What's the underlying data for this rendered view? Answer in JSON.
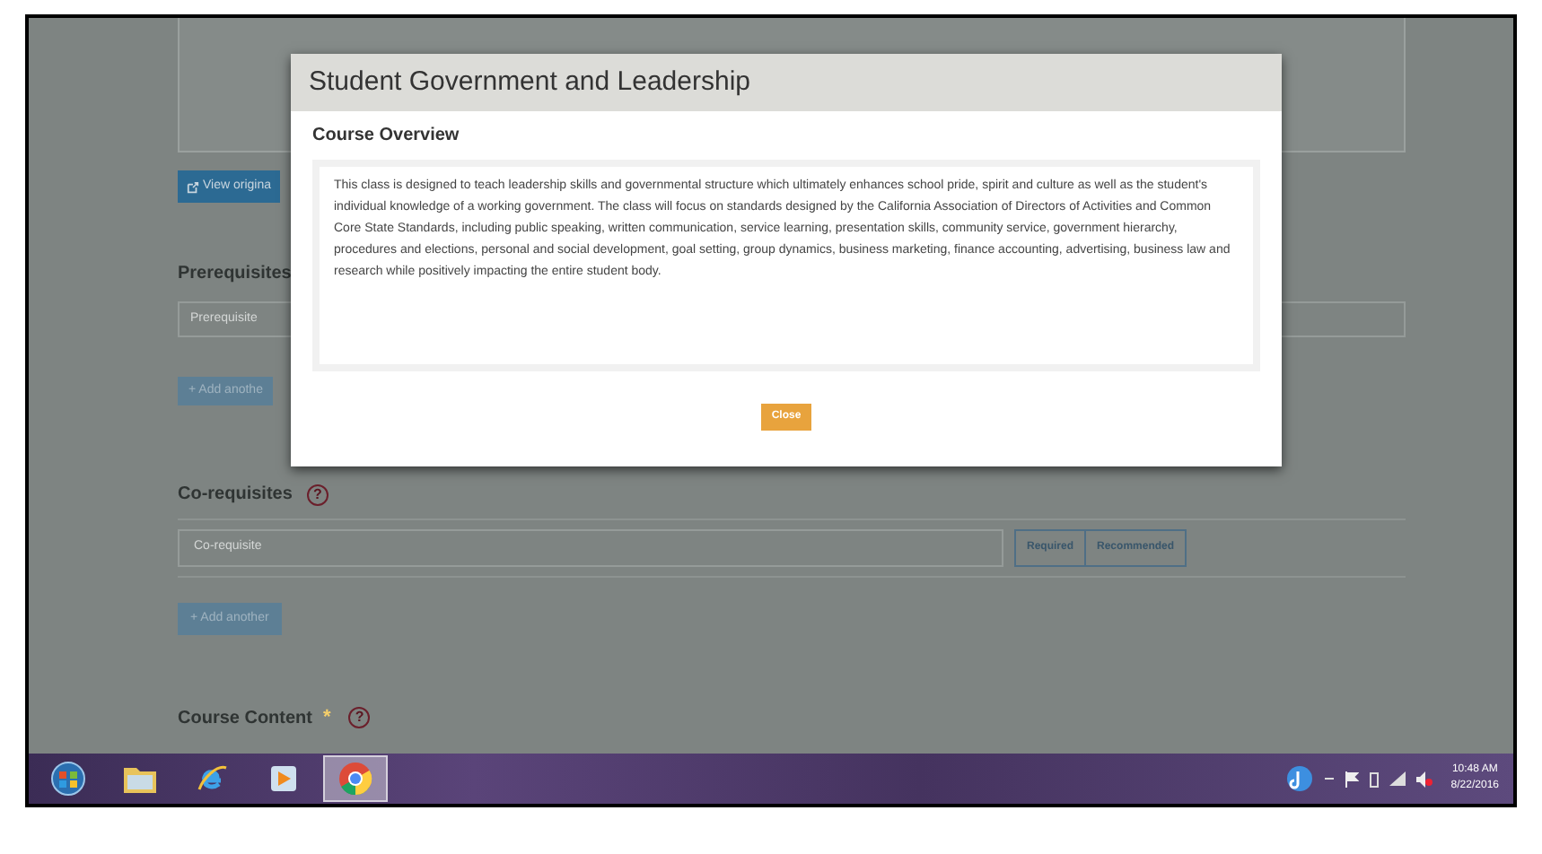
{
  "page": {
    "view_original_button": "View origina",
    "prerequisites": {
      "heading": "Prerequisites",
      "placeholder": "Prerequisite",
      "add_button": "+ Add anothe"
    },
    "corequisites": {
      "heading": "Co-requisites",
      "help": "?",
      "placeholder": "Co-requisite",
      "options": [
        "Required",
        "Recommended"
      ],
      "add_button": "+ Add another"
    },
    "course_content": {
      "heading": "Course Content",
      "required_mark": "*",
      "help": "?"
    }
  },
  "modal": {
    "title": "Student Government and Leadership",
    "section": "Course Overview",
    "body": "This class is designed to teach leadership skills and governmental structure which ultimately enhances school pride, spirit and culture as well as the student's individual knowledge of a working government.  The class will focus on standards designed by the California Association of Directors of Activities and Common Core State Standards, including public speaking, written communication, service learning, presentation skills, community service, government hierarchy, procedures and elections, personal and social development, goal setting, group dynamics, business marketing, finance accounting, advertising, business law and research while positively impacting the entire student body.",
    "close_button": "Close"
  },
  "taskbar": {
    "apps": [
      {
        "kind": "start",
        "active": false
      },
      {
        "kind": "folder",
        "active": false
      },
      {
        "kind": "browser-e",
        "active": false
      },
      {
        "kind": "media",
        "active": false
      },
      {
        "kind": "chrome",
        "active": true
      }
    ],
    "clock": {
      "time": "10:48 AM",
      "date": "8/22/2016"
    }
  }
}
